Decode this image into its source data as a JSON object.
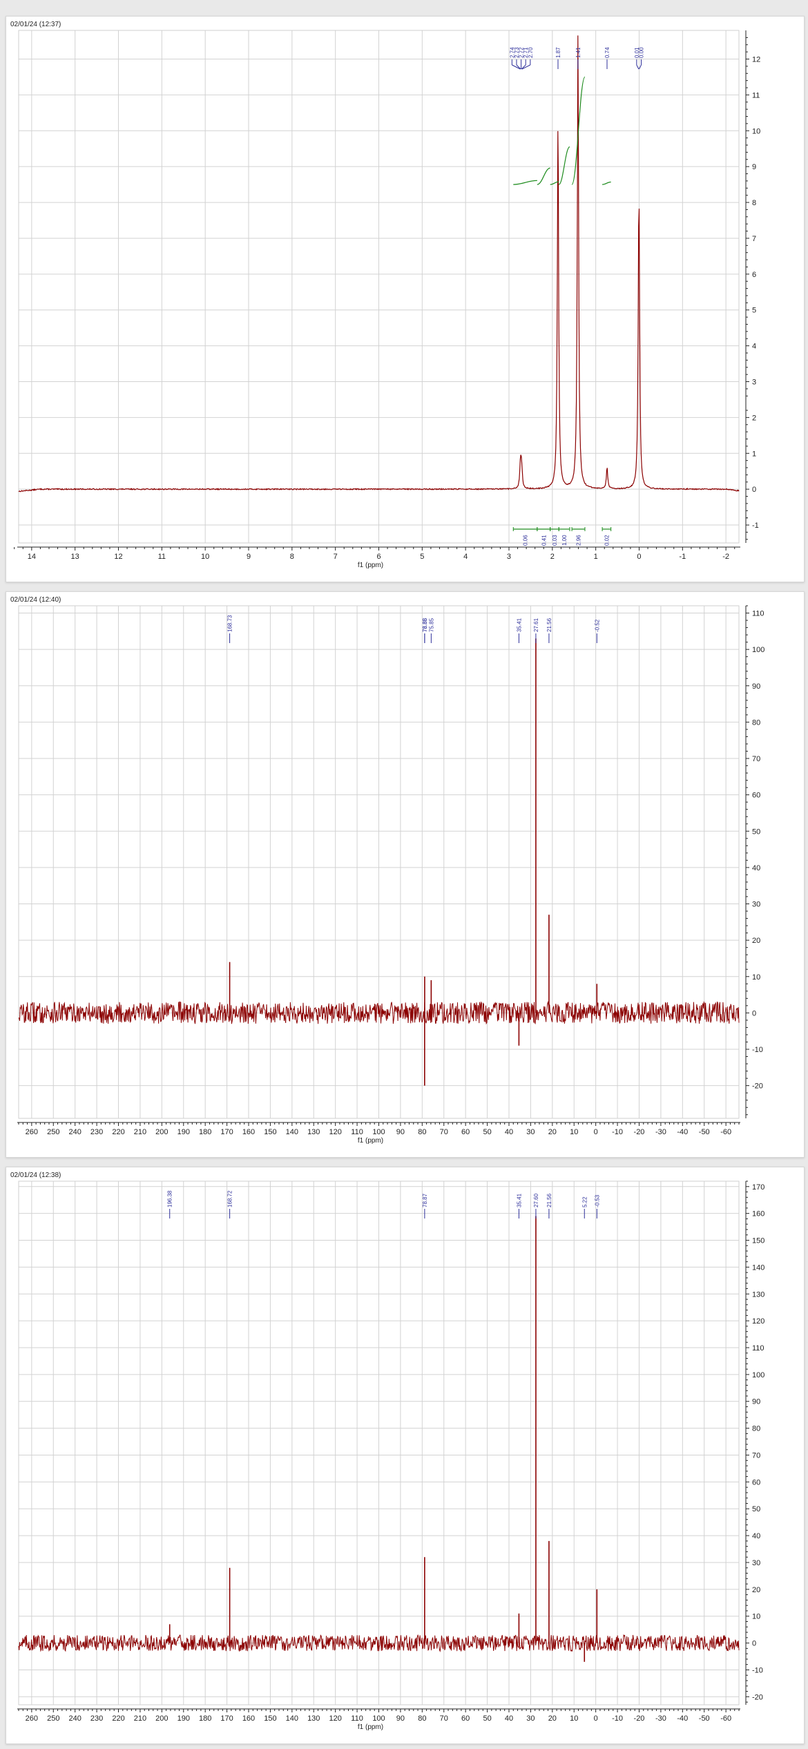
{
  "chart_data": [
    {
      "type": "line",
      "timestamp": "02/01/24  (12:37)",
      "xlabel": "f1 (ppm)",
      "xlim": [
        14.3,
        -2.3
      ],
      "ylim": [
        -1.5,
        12.8
      ],
      "x_ticks": [
        14,
        13,
        12,
        11,
        10,
        9,
        8,
        7,
        6,
        5,
        4,
        3,
        2,
        1,
        0,
        -1,
        -2
      ],
      "y_ticks": [
        -1,
        0,
        1,
        2,
        3,
        4,
        5,
        6,
        7,
        8,
        9,
        10,
        11,
        12
      ],
      "grid": true,
      "spectrum_color": "#8b0000",
      "label_color": "#2d2f9a",
      "integral_color": "#1e8c1e",
      "peaks": [
        {
          "x": 2.74,
          "y": 0.35,
          "label": "2.74"
        },
        {
          "x": 2.73,
          "y": 0.3,
          "label": "2.73"
        },
        {
          "x": 2.72,
          "y": 0.28,
          "label": "2.72"
        },
        {
          "x": 2.71,
          "y": 0.25,
          "label": "2.71"
        },
        {
          "x": 2.7,
          "y": 0.2,
          "label": "2.70"
        },
        {
          "x": 1.87,
          "y": 10.4,
          "label": "1.87"
        },
        {
          "x": 1.41,
          "y": 12.7,
          "label": "1.41"
        },
        {
          "x": 0.74,
          "y": 0.6,
          "label": "0.74"
        },
        {
          "x": 0.01,
          "y": 4.3,
          "label": "0.01"
        },
        {
          "x": 0.0,
          "y": 4.5,
          "label": "0.00"
        }
      ],
      "integrals": [
        {
          "from": 2.9,
          "to": 2.35,
          "value": "0.06"
        },
        {
          "from": 2.35,
          "to": 2.05,
          "value": "0.41"
        },
        {
          "from": 2.05,
          "to": 1.85,
          "value": "0.03"
        },
        {
          "from": 1.85,
          "to": 1.6,
          "value": "1.00"
        },
        {
          "from": 1.55,
          "to": 1.25,
          "value": "2.96"
        },
        {
          "from": 0.85,
          "to": 0.65,
          "value": "0.02"
        }
      ]
    },
    {
      "type": "line",
      "timestamp": "02/01/24  (12:40)",
      "xlabel": "f1 (ppm)",
      "xlim": [
        266,
        -66
      ],
      "ylim": [
        -29,
        112
      ],
      "x_ticks": [
        260,
        250,
        240,
        230,
        220,
        210,
        200,
        190,
        180,
        170,
        160,
        150,
        140,
        130,
        120,
        110,
        100,
        90,
        80,
        70,
        60,
        50,
        40,
        30,
        20,
        10,
        0,
        -10,
        -20,
        -30,
        -40,
        -50,
        -60
      ],
      "y_ticks": [
        -20,
        -10,
        0,
        10,
        20,
        30,
        40,
        50,
        60,
        70,
        80,
        90,
        100,
        110
      ],
      "grid": true,
      "spectrum_color": "#8b0000",
      "label_color": "#2d2f9a",
      "noise": 3,
      "peaks": [
        {
          "x": 168.73,
          "y": 14,
          "label": "168.73"
        },
        {
          "x": 78.88,
          "y": -20,
          "label": "78.88"
        },
        {
          "x": 78.85,
          "y": 10,
          "label": "78.85"
        },
        {
          "x": 75.85,
          "y": 9,
          "label": "75.85"
        },
        {
          "x": 35.41,
          "y": -9,
          "label": "35.41"
        },
        {
          "x": 27.61,
          "y": 103,
          "label": "27.61"
        },
        {
          "x": 21.56,
          "y": 27,
          "label": "21.56"
        },
        {
          "x": -0.52,
          "y": 8,
          "label": "-0.52"
        }
      ]
    },
    {
      "type": "line",
      "timestamp": "02/01/24  (12:38)",
      "xlabel": "f1 (ppm)",
      "xlim": [
        266,
        -66
      ],
      "ylim": [
        -23,
        172
      ],
      "x_ticks": [
        260,
        250,
        240,
        230,
        220,
        210,
        200,
        190,
        180,
        170,
        160,
        150,
        140,
        130,
        120,
        110,
        100,
        90,
        80,
        70,
        60,
        50,
        40,
        30,
        20,
        10,
        0,
        -10,
        -20,
        -30,
        -40,
        -50,
        -60
      ],
      "y_ticks": [
        -20,
        -10,
        0,
        10,
        20,
        30,
        40,
        50,
        60,
        70,
        80,
        90,
        100,
        110,
        120,
        130,
        140,
        150,
        160,
        170
      ],
      "grid": true,
      "spectrum_color": "#8b0000",
      "label_color": "#2d2f9a",
      "noise": 3,
      "peaks": [
        {
          "x": 196.38,
          "y": 7,
          "label": "196.38"
        },
        {
          "x": 168.72,
          "y": 28,
          "label": "168.72"
        },
        {
          "x": 78.87,
          "y": 32,
          "label": "78.87"
        },
        {
          "x": 35.41,
          "y": 11,
          "label": "35.41"
        },
        {
          "x": 27.6,
          "y": 159,
          "label": "27.60"
        },
        {
          "x": 21.56,
          "y": 38,
          "label": "21.56"
        },
        {
          "x": 5.22,
          "y": -7,
          "label": "5.22"
        },
        {
          "x": -0.53,
          "y": 20,
          "label": "-0.53"
        }
      ]
    }
  ]
}
